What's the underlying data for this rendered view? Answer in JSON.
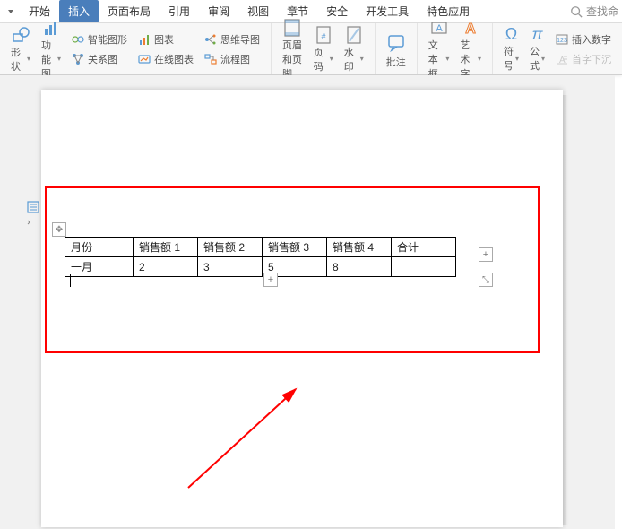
{
  "menubar": {
    "items": [
      "开始",
      "插入",
      "页面布局",
      "引用",
      "审阅",
      "视图",
      "章节",
      "安全",
      "开发工具",
      "特色应用"
    ],
    "active_index": 1,
    "search_placeholder": "查找命"
  },
  "ribbon": {
    "shape": "形状",
    "function_chart": "功能图",
    "smart_graphic": "智能图形",
    "relation_chart": "关系图",
    "chart": "图表",
    "online_chart": "在线图表",
    "mindmap": "思维导图",
    "flowchart": "流程图",
    "header_footer": "页眉和页脚",
    "page_number": "页码",
    "watermark": "水印",
    "annotate": "批注",
    "textbox": "文本框",
    "wordart": "艺术字",
    "symbol": "符号",
    "formula": "公式",
    "insert_number": "插入数字",
    "drop_cap": "首字下沉"
  },
  "table": {
    "headers": [
      "月份",
      "销售额 1",
      "销售额 2",
      "销售额 3",
      "销售额 4",
      "合计"
    ],
    "row1": [
      "一月",
      "2",
      "3",
      "5",
      "8",
      ""
    ]
  },
  "glyphs": {
    "plus": "+",
    "expand": "⤡",
    "move": "✥"
  }
}
